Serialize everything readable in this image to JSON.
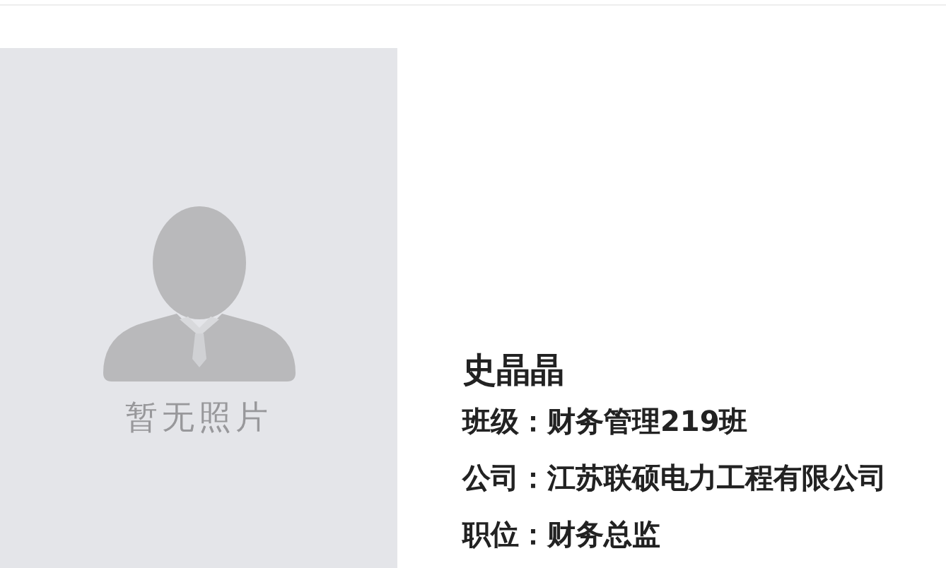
{
  "photo": {
    "placeholder": "暂无照片"
  },
  "profile": {
    "name": "史晶晶",
    "lines": [
      {
        "text": "班级：财务管理219班"
      },
      {
        "text": "公司：江苏联硕电力工程有限公司"
      },
      {
        "text": "职位：财务总监"
      }
    ]
  }
}
